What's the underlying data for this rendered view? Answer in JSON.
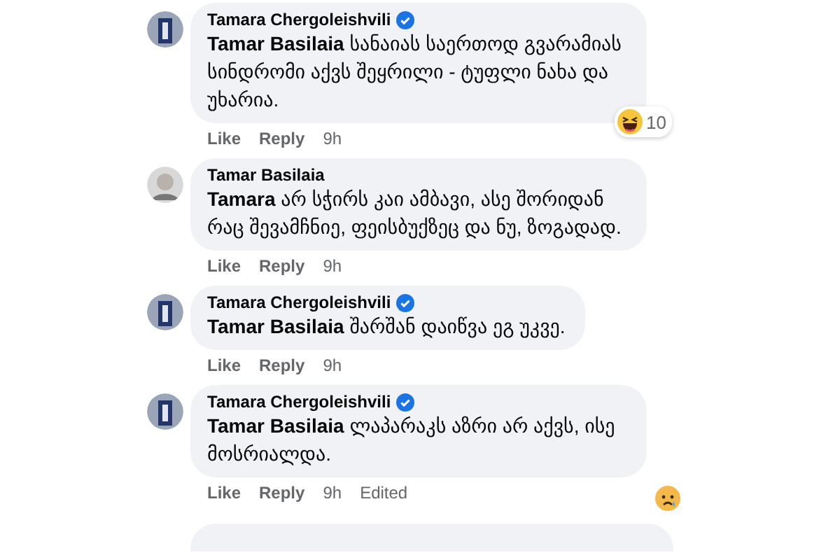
{
  "comments": [
    {
      "author": "Tamara Chergoleishvili",
      "verified": true,
      "kind": "page",
      "mention": "Tamar Basilaia",
      "text": "სანაიას საერთოდ გვარამიას სინდრომი აქვს შეყრილი - ტუფლი ნახა და უხარია.",
      "actions": [
        "Like",
        "Reply"
      ],
      "time": "9h",
      "reaction": {
        "kind": "haha",
        "count": "10"
      }
    },
    {
      "author": "Tamar Basilaia",
      "verified": false,
      "kind": "person",
      "mention": "Tamara",
      "text": "არ სჭირს კაი ამბავი, ასე შორიდან რაც შევამჩნიე, ფეისბუქზეც და ნუ, ზოგადად.",
      "actions": [
        "Like",
        "Reply"
      ],
      "time": "9h"
    },
    {
      "author": "Tamara Chergoleishvili",
      "verified": true,
      "kind": "page",
      "mention": "Tamar Basilaia",
      "text": "შარშან დაიწვა ეგ უკვე.",
      "actions": [
        "Like",
        "Reply"
      ],
      "time": "9h"
    },
    {
      "author": "Tamara Chergoleishvili",
      "verified": true,
      "kind": "page",
      "mention": "Tamar Basilaia",
      "text": "ლაპარაკს აზრი არ აქვს, ისე მოსრიალდა.",
      "actions": [
        "Like",
        "Reply"
      ],
      "time": "9h",
      "edited": "Edited",
      "reaction": {
        "kind": "sad"
      }
    }
  ]
}
